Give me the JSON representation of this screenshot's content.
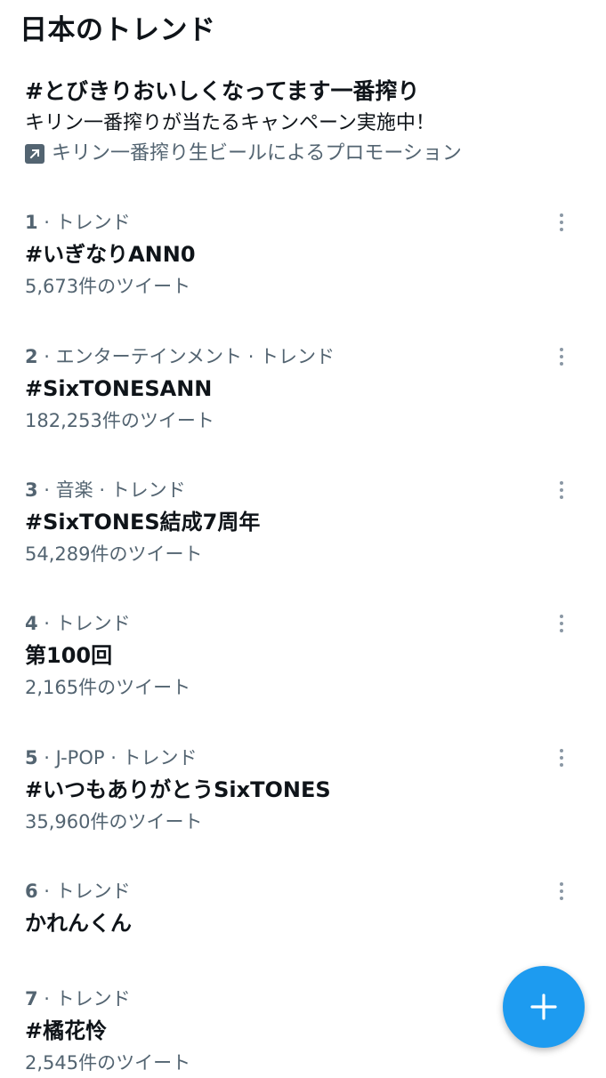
{
  "header": {
    "title": "日本のトレンド"
  },
  "promoted": {
    "title": "#とびきりおいしくなってます一番搾り",
    "description": "キリン一番搾りが当たるキャンペーン実施中！",
    "byline": "キリン一番搾り生ビールによるプロモーション",
    "icon": "promoted-arrow-icon"
  },
  "trends": [
    {
      "rank": "1",
      "category": " · トレンド",
      "name": "#いぎなりANN0",
      "count": "5,673件のツイート"
    },
    {
      "rank": "2",
      "category": " · エンターテインメント · トレンド",
      "name": "#SixTONESANN",
      "count": "182,253件のツイート"
    },
    {
      "rank": "3",
      "category": " · 音楽 · トレンド",
      "name": "#SixTONES結成7周年",
      "count": "54,289件のツイート"
    },
    {
      "rank": "4",
      "category": " · トレンド",
      "name": "第100回",
      "count": "2,165件のツイート"
    },
    {
      "rank": "5",
      "category": " · J-POP · トレンド",
      "name": "#いつもありがとうSixTONES",
      "count": "35,960件のツイート"
    },
    {
      "rank": "6",
      "category": " · トレンド",
      "name": "かれんくん",
      "count": ""
    },
    {
      "rank": "7",
      "category": " · トレンド",
      "name": "#橘花怜",
      "count": "2,545件のツイート"
    }
  ],
  "fab": {
    "icon": "plus-icon",
    "color": "#1d9bf0"
  },
  "colors": {
    "text": "#0f1419",
    "secondary": "#536471",
    "accent": "#1d9bf0"
  }
}
